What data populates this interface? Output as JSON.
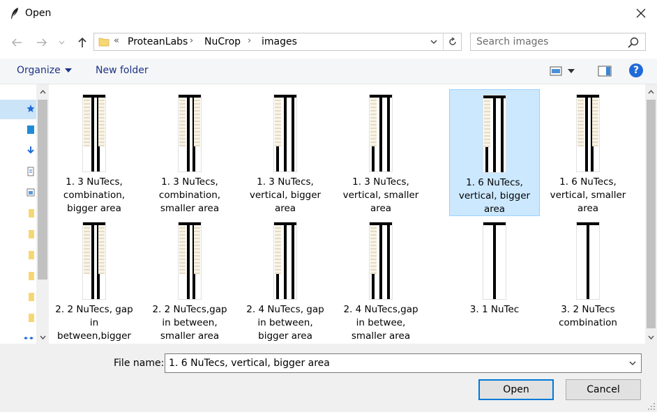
{
  "window": {
    "title": "Open",
    "close_icon": "close-icon",
    "app_icon": "feather-icon"
  },
  "navigation": {
    "back_icon": "arrow-left-icon",
    "forward_icon": "arrow-right-icon",
    "recent_icon": "chevron-down-icon",
    "up_icon": "arrow-up-icon",
    "overflow": "«",
    "breadcrumbs": [
      "ProteanLabs",
      "NuCrop",
      "images"
    ],
    "refresh_icon": "refresh-icon"
  },
  "search": {
    "placeholder": "Search images",
    "icon": "search-icon"
  },
  "toolbar": {
    "organize_label": "Organize",
    "new_folder_label": "New folder",
    "help_label": "?"
  },
  "files": [
    {
      "name": "1. 3 NuTecs,\ncombination,\nbigger area",
      "bars": 2,
      "selected": false
    },
    {
      "name": "1. 3 NuTecs,\ncombination,\nsmaller area",
      "bars": 2,
      "selected": false
    },
    {
      "name": "1. 3 NuTecs,\nvertical, bigger\narea",
      "bars": 3,
      "selected": false
    },
    {
      "name": "1. 3 NuTecs,\nvertical, smaller\narea",
      "bars": 3,
      "selected": false
    },
    {
      "name": "1. 6 NuTecs,\nvertical, bigger\narea",
      "bars": 3,
      "selected": true
    },
    {
      "name": "1. 6 NuTecs,\nvertical, smaller\narea",
      "bars": 2,
      "selected": false
    },
    {
      "name": "2. 2 NuTecs, gap\nin\nbetween,bigger",
      "bars": 2,
      "selected": false
    },
    {
      "name": "2. 2 NuTecs,gap\nin between,\nsmaller area",
      "bars": 2,
      "selected": false
    },
    {
      "name": "2. 4 NuTecs, gap\nin between,\nbigger area",
      "bars": 3,
      "selected": false
    },
    {
      "name": "2. 4 NuTecs,gap\nin betwee,\nsmaller area",
      "bars": 3,
      "selected": false
    },
    {
      "name": "3. 1 NuTec",
      "bars": 1,
      "selected": false
    },
    {
      "name": "3. 2 NuTecs\ncombination",
      "bars": 1,
      "selected": false
    }
  ],
  "bottom": {
    "file_name_label": "File name:",
    "file_name_value": "1. 6 NuTecs, vertical, bigger area",
    "open_label": "Open",
    "cancel_label": "Cancel"
  },
  "colors": {
    "selection": "#cce8ff",
    "accent": "#0078d7",
    "link": "#1e3287"
  }
}
